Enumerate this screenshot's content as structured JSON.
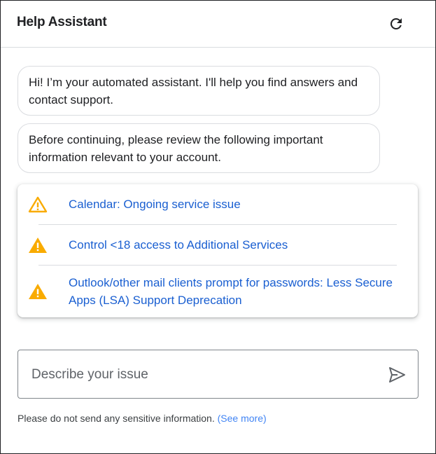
{
  "header": {
    "title": "Help Assistant",
    "refresh_icon": "refresh-icon"
  },
  "messages": [
    {
      "text": "Hi! I’m your automated assistant. I'll help you find answers and contact support."
    },
    {
      "text": "Before continuing, please review the following important information relevant to your account."
    }
  ],
  "alerts": [
    {
      "icon": "warning-outline-icon",
      "label": "Calendar: Ongoing service issue"
    },
    {
      "icon": "warning-filled-icon",
      "label": "Control <18 access to Additional Services"
    },
    {
      "icon": "warning-filled-icon",
      "label": "Outlook/other mail clients prompt for passwords: Less Secure Apps (LSA) Support Deprecation"
    }
  ],
  "input": {
    "placeholder": "Describe your issue",
    "value": "",
    "send_icon": "send-icon"
  },
  "footer": {
    "notice": "Please do not send any sensitive information.",
    "see_more": "(See more)"
  },
  "colors": {
    "warning": "#f9ab00",
    "link": "#1a5fd1",
    "see_more": "#4285f4"
  }
}
